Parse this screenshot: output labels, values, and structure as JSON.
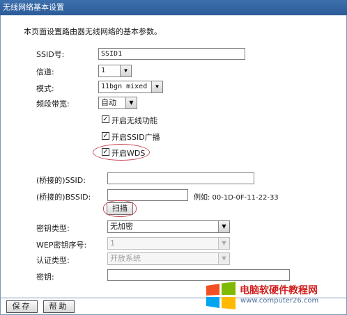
{
  "window": {
    "title": "无线网络基本设置"
  },
  "description": "本页面设置路由器无线网络的基本参数。",
  "ssid": {
    "label": "SSID号:",
    "value": "SSID1"
  },
  "channel": {
    "label": "信道:",
    "value": "1"
  },
  "mode": {
    "label": "模式:",
    "value": "11bgn mixed"
  },
  "bandwidth": {
    "label": "频段带宽:",
    "value": "自动"
  },
  "options": {
    "wireless": {
      "label": "开启无线功能",
      "checked": true
    },
    "ssid_broadcast": {
      "label": "开启SSID广播",
      "checked": true
    },
    "wds": {
      "label": "开启WDS",
      "checked": true
    }
  },
  "bridge": {
    "ssid_label": "(桥接的)SSID:",
    "ssid_value": "",
    "bssid_label": "(桥接的)BSSID:",
    "bssid_value": "",
    "example": "例如: 00-1D-0F-11-22-33",
    "scan_label": "扫描"
  },
  "key_type": {
    "label": "密钥类型:",
    "value": "无加密"
  },
  "wep_index": {
    "label": "WEP密钥序号:",
    "value": "1"
  },
  "auth_type": {
    "label": "认证类型:",
    "value": "开放系统"
  },
  "key": {
    "label": "密钥:",
    "value": ""
  },
  "footer": {
    "save_label": "保存",
    "help_label": "帮助"
  },
  "watermark": {
    "title": "电脑软硬件教程网",
    "url": "www.computer26.com"
  },
  "colors": {
    "titlebar": "#2f5f9e",
    "highlight": "#c8505a",
    "watermark_title": "#d01e1e"
  }
}
